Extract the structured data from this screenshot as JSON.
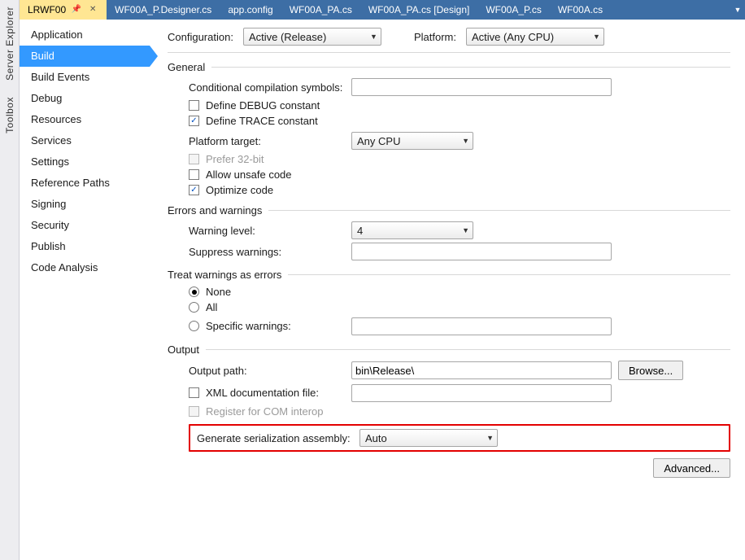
{
  "leftStrip": {
    "items": [
      "Server Explorer",
      "Toolbox"
    ]
  },
  "tabs": {
    "items": [
      {
        "label": "LRWF00",
        "active": true,
        "pinned": true
      },
      {
        "label": "WF00A_P.Designer.cs",
        "active": false
      },
      {
        "label": "app.config",
        "active": false
      },
      {
        "label": "WF00A_PA.cs",
        "active": false
      },
      {
        "label": "WF00A_PA.cs [Design]",
        "active": false
      },
      {
        "label": "WF00A_P.cs",
        "active": false
      },
      {
        "label": "WF00A.cs",
        "active": false
      }
    ]
  },
  "categories": {
    "items": [
      "Application",
      "Build",
      "Build Events",
      "Debug",
      "Resources",
      "Services",
      "Settings",
      "Reference Paths",
      "Signing",
      "Security",
      "Publish",
      "Code Analysis"
    ],
    "selected": "Build"
  },
  "top": {
    "configLabel": "Configuration:",
    "configValue": "Active (Release)",
    "platformLabel": "Platform:",
    "platformValue": "Active (Any CPU)"
  },
  "sections": {
    "general": "General",
    "errors": "Errors and warnings",
    "treat": "Treat warnings as errors",
    "output": "Output"
  },
  "general": {
    "condSymLabel": "Conditional compilation symbols:",
    "condSymValue": "",
    "defineDebug": "Define DEBUG constant",
    "defineDebugChecked": false,
    "defineTrace": "Define TRACE constant",
    "defineTraceChecked": true,
    "platformTargetLabel": "Platform target:",
    "platformTargetValue": "Any CPU",
    "prefer32": "Prefer 32-bit",
    "prefer32Enabled": false,
    "allowUnsafe": "Allow unsafe code",
    "allowUnsafeChecked": false,
    "optimize": "Optimize code",
    "optimizeChecked": true
  },
  "errors": {
    "warnLevelLabel": "Warning level:",
    "warnLevelValue": "4",
    "suppressLabel": "Suppress warnings:",
    "suppressValue": ""
  },
  "treat": {
    "none": "None",
    "all": "All",
    "specific": "Specific warnings:",
    "selected": "None",
    "specificValue": ""
  },
  "output": {
    "outPathLabel": "Output path:",
    "outPathValue": "bin\\Release\\",
    "browse": "Browse...",
    "xmlDoc": "XML documentation file:",
    "xmlDocChecked": false,
    "xmlDocValue": "",
    "registerCom": "Register for COM interop",
    "registerComEnabled": false,
    "genSerLabel": "Generate serialization assembly:",
    "genSerValue": "Auto"
  },
  "footer": {
    "advanced": "Advanced..."
  }
}
